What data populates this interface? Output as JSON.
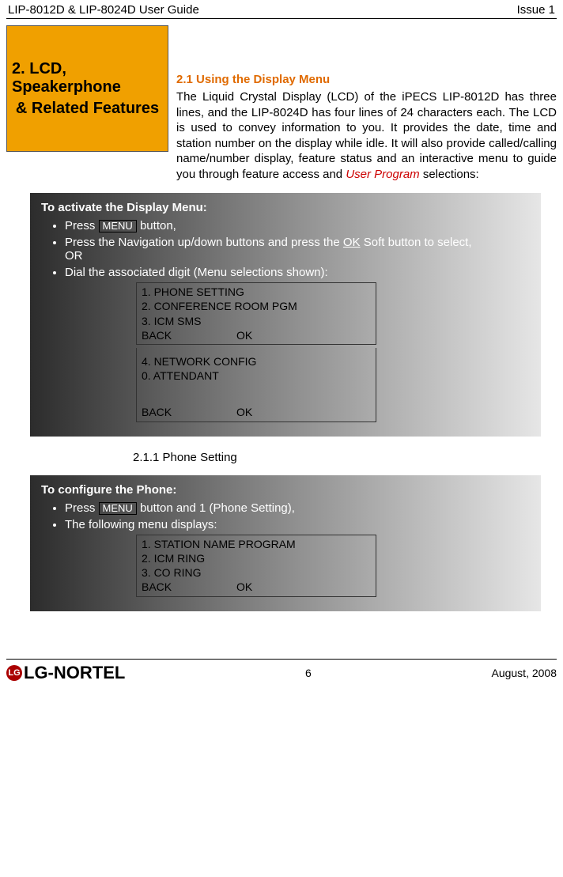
{
  "header": {
    "left": "LIP-8012D & LIP-8024D User Guide",
    "right": "Issue 1"
  },
  "chapter": {
    "line1": "2. LCD, Speakerphone",
    "line2": "& Related Features"
  },
  "section": {
    "heading": "2.1    Using the Display Menu",
    "body_prefix": "The Liquid Crystal Display (LCD) of the iPECS LIP-8012D has three lines, and the LIP-8024D has four lines of 24 characters each.  The LCD is used to convey information to you.  It provides the date, time and station number on the display while idle.  It will also provide called/calling name/number display, feature status and an interactive menu to guide you through feature access and ",
    "body_user_program": "User Program",
    "body_suffix": " selections:"
  },
  "menu_button": "MENU",
  "ok_word": "OK",
  "or_word": "OR",
  "panel1": {
    "title": "To activate the Display Menu:",
    "b1a": "Press ",
    "b1b": " button,",
    "b2a": "Press the Navigation up/down buttons and press the ",
    "b2b": " Soft button to select,",
    "b3": "Dial the associated digit (Menu selections shown):",
    "lcd1": {
      "l1": "1. PHONE SETTING",
      "l2": "2. CONFERENCE ROOM PGM",
      "l3": "3. ICM SMS",
      "back": " BACK",
      "ok": "OK"
    },
    "lcd2": {
      "l1": "4. NETWORK CONFIG",
      "l2": "0. ATTENDANT",
      "back": "BACK",
      "ok": "OK"
    }
  },
  "subsection": {
    "heading": "2.1.1  Phone Setting"
  },
  "panel2": {
    "title": "To configure the Phone:",
    "b1a": "Press ",
    "b1b": " button and 1 (Phone Setting),",
    "b2": "The following menu displays:",
    "lcd": {
      "l1": "1. STATION NAME PROGRAM",
      "l2": "2. ICM RING",
      "l3": "3. CO RING",
      "back": "BACK",
      "ok": "OK"
    }
  },
  "footer": {
    "logo": "LG-NORTEL",
    "page": "6",
    "date": "August, 2008"
  }
}
